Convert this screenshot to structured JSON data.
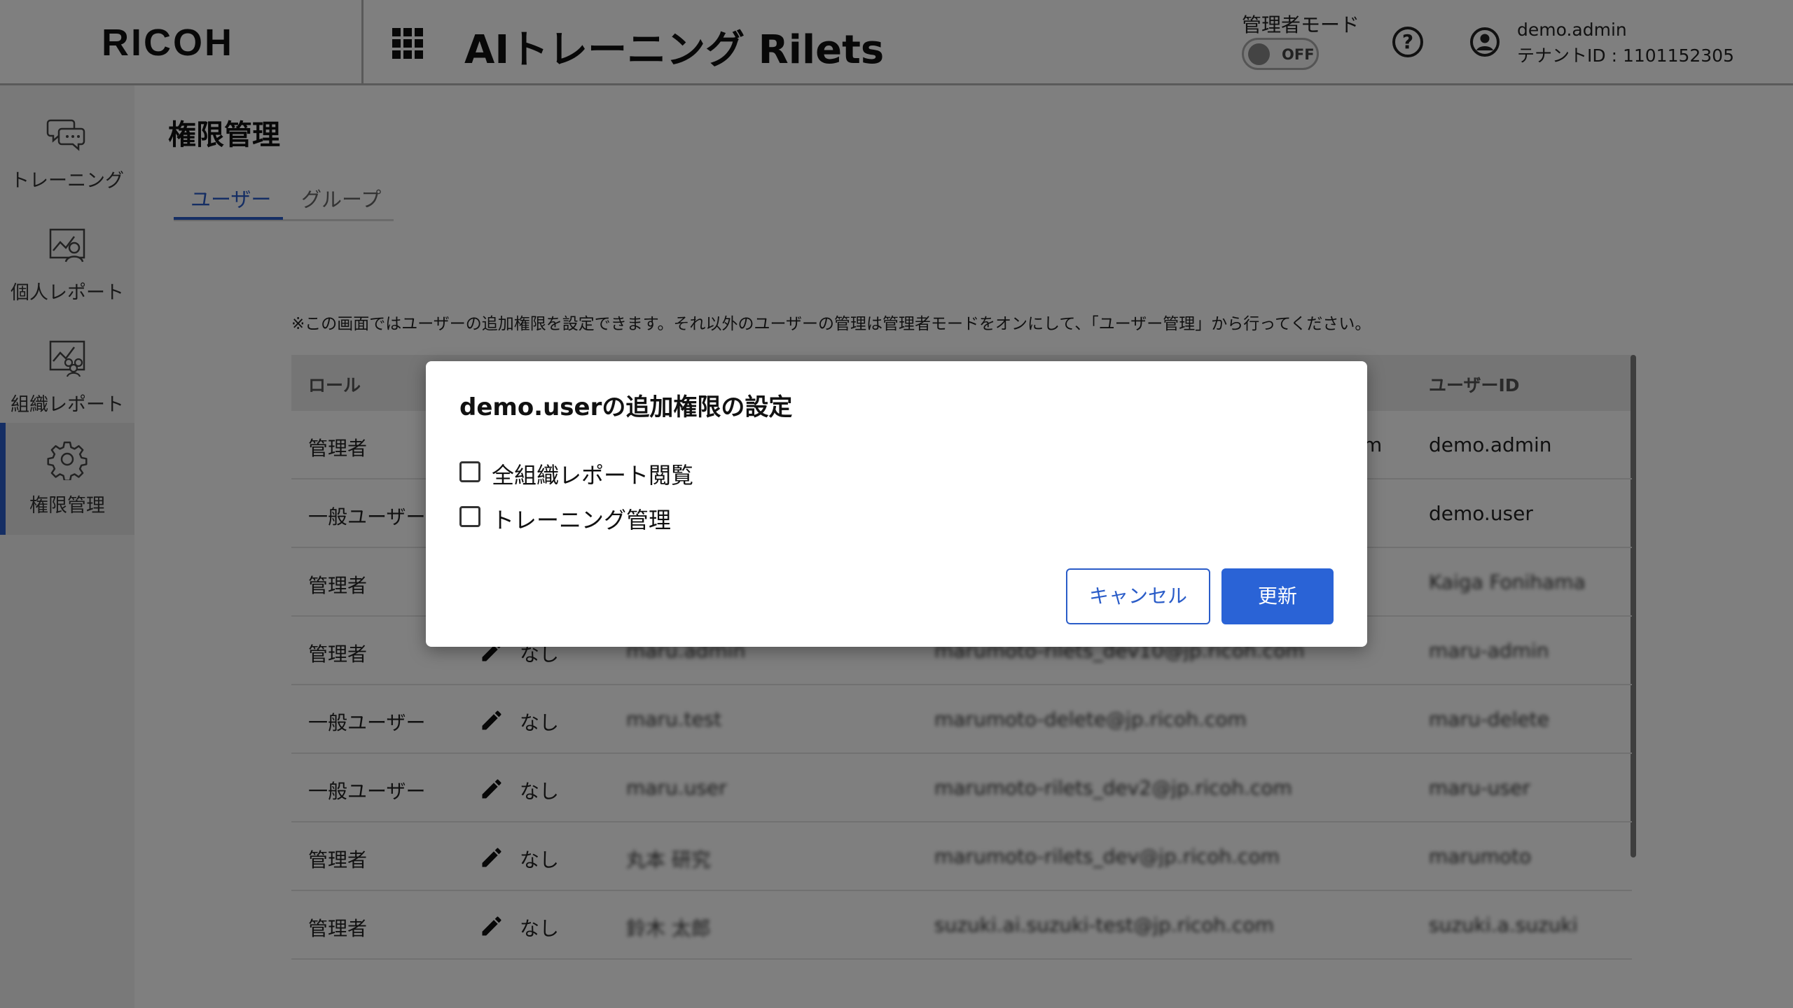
{
  "header": {
    "logo": "RICOH",
    "app_title": "AIトレーニング Rilets",
    "admin_mode_label": "管理者モード",
    "admin_toggle_text": "OFF",
    "help_glyph": "?",
    "user_name": "demo.admin",
    "tenant_id": "テナントID : 1101152305"
  },
  "sidebar": {
    "items": [
      {
        "label": "トレーニング",
        "icon": "chat-icon"
      },
      {
        "label": "個人レポート",
        "icon": "person-report-icon"
      },
      {
        "label": "組織レポート",
        "icon": "group-report-icon"
      },
      {
        "label": "権限管理",
        "icon": "gear-icon"
      }
    ]
  },
  "main": {
    "page_title": "権限管理",
    "tabs": [
      {
        "label": "ユーザー"
      },
      {
        "label": "グループ"
      }
    ],
    "notice": "※この画面ではユーザーの追加権限を設定できます。それ以外のユーザーの管理は管理者モードをオンにして、「ユーザー管理」から行ってください。",
    "table": {
      "headers": {
        "role": "ロール",
        "user_id": "ユーザーID"
      },
      "rows": [
        {
          "role": "管理者",
          "perm": "",
          "name": "",
          "email": "m",
          "uid": "demo.admin"
        },
        {
          "role": "一般ユーザー",
          "perm": "",
          "name": "",
          "email": "",
          "uid": "demo.user"
        },
        {
          "role": "管理者",
          "perm": "",
          "name": "",
          "email": "",
          "uid": "Kaiga Fonihama"
        },
        {
          "role": "管理者",
          "perm": "なし",
          "name": "maru.admin",
          "email": "marumoto-rilets_dev10@jp.ricoh.com",
          "uid": "maru-admin"
        },
        {
          "role": "一般ユーザー",
          "perm": "なし",
          "name": "maru.test",
          "email": "marumoto-delete@jp.ricoh.com",
          "uid": "maru-delete"
        },
        {
          "role": "一般ユーザー",
          "perm": "なし",
          "name": "maru.user",
          "email": "marumoto-rilets_dev2@jp.ricoh.com",
          "uid": "maru-user"
        },
        {
          "role": "管理者",
          "perm": "なし",
          "name": "丸本 研究",
          "email": "marumoto-rilets_dev@jp.ricoh.com",
          "uid": "marumoto"
        },
        {
          "role": "管理者",
          "perm": "なし",
          "name": "鈴木 太郎",
          "email": "suzuki.ai.suzuki-test@jp.ricoh.com",
          "uid": "suzuki.a.suzuki"
        }
      ]
    }
  },
  "dialog": {
    "title": "demo.userの追加権限の設定",
    "options": [
      {
        "label": "全組織レポート閲覧",
        "checked": false
      },
      {
        "label": "トレーニング管理",
        "checked": false
      }
    ],
    "cancel_label": "キャンセル",
    "update_label": "更新"
  },
  "colors": {
    "accent": "#2a5cc8",
    "button_primary": "#2a63d6",
    "overlay": "rgba(0,0,0,0.5)"
  }
}
